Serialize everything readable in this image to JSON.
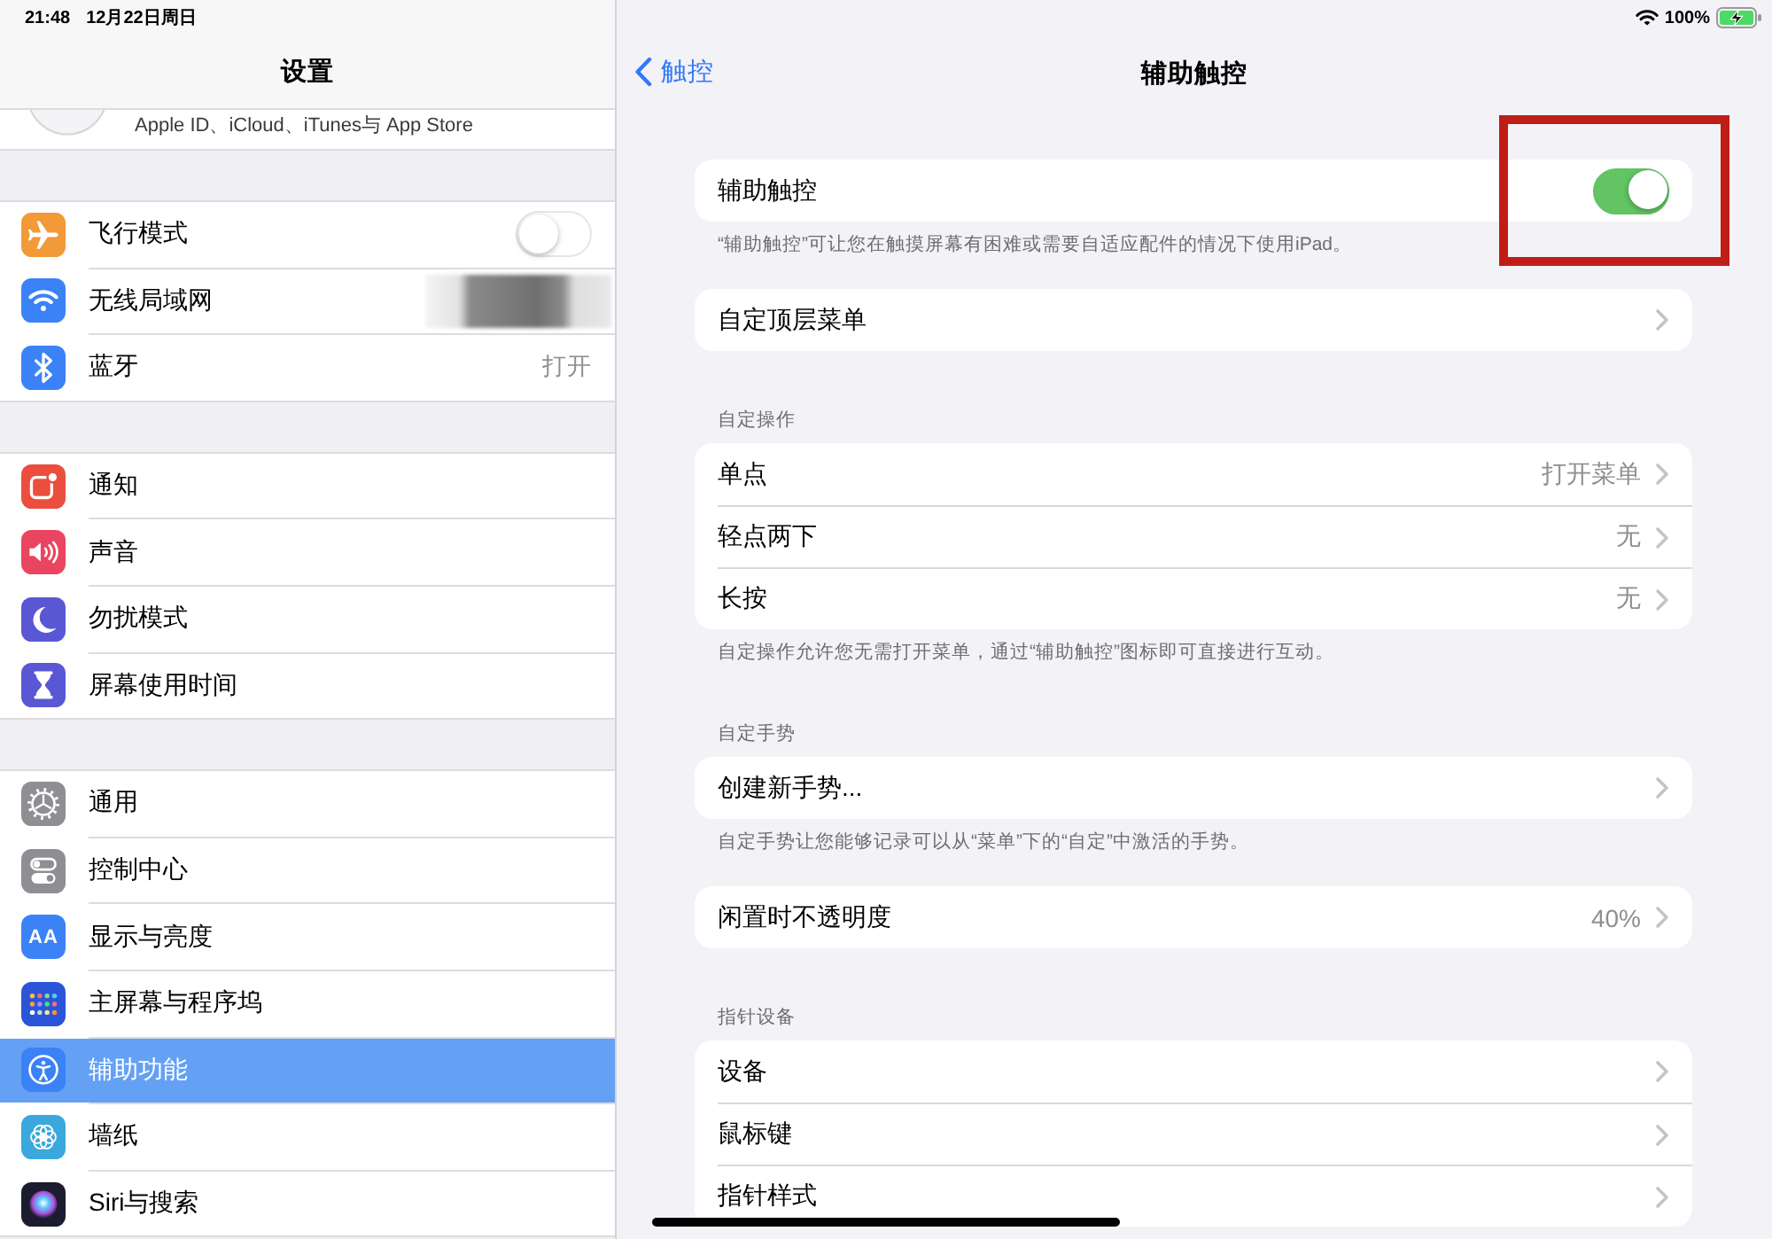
{
  "status_bar": {
    "time": "21:48",
    "date": "12月22日周日",
    "battery": "100%",
    "charging": true
  },
  "sidebar": {
    "title": "设置",
    "account": {
      "subtitle": "Apple ID、iCloud、iTunes与 App Store"
    },
    "groups": [
      {
        "items": [
          {
            "label": "飞行模式",
            "kind": "toggle",
            "on": false,
            "selected": false
          },
          {
            "label": "无线局域网",
            "kind": "hidden",
            "selected": false
          },
          {
            "label": "蓝牙",
            "kind": "value",
            "value": "打开",
            "selected": false
          }
        ]
      },
      {
        "items": [
          {
            "label": "通知",
            "kind": "plain",
            "selected": false
          },
          {
            "label": "声音",
            "kind": "plain",
            "selected": false
          },
          {
            "label": "勿扰模式",
            "kind": "plain",
            "selected": false
          },
          {
            "label": "屏幕使用时间",
            "kind": "plain",
            "selected": false
          }
        ]
      },
      {
        "items": [
          {
            "label": "通用",
            "kind": "plain",
            "selected": false
          },
          {
            "label": "控制中心",
            "kind": "plain",
            "selected": false
          },
          {
            "label": "显示与亮度",
            "kind": "plain",
            "icon_text": "AA",
            "selected": false
          },
          {
            "label": "主屏幕与程序坞",
            "kind": "plain",
            "selected": false
          },
          {
            "label": "辅助功能",
            "kind": "plain",
            "selected": true
          },
          {
            "label": "墙纸",
            "kind": "plain",
            "selected": false
          },
          {
            "label": "Siri与搜索",
            "kind": "plain",
            "selected": false
          }
        ]
      }
    ]
  },
  "detail": {
    "back": "触控",
    "title": "辅助触控",
    "sections": [
      {
        "rows": [
          {
            "label": "辅助触控",
            "kind": "toggle",
            "on": true,
            "highlighted": true
          }
        ],
        "footer": "“辅助触控”可让您在触摸屏幕有困难或需要自适应配件的情况下使用iPad。"
      },
      {
        "rows": [
          {
            "label": "自定顶层菜单",
            "kind": "link"
          }
        ]
      },
      {
        "header": "自定操作",
        "rows": [
          {
            "label": "单点",
            "kind": "link",
            "value": "打开菜单"
          },
          {
            "label": "轻点两下",
            "kind": "link",
            "value": "无"
          },
          {
            "label": "长按",
            "kind": "link",
            "value": "无"
          }
        ],
        "footer": "自定操作允许您无需打开菜单，通过“辅助触控”图标即可直接进行互动。"
      },
      {
        "header": "自定手势",
        "rows": [
          {
            "label": "创建新手势...",
            "kind": "link"
          }
        ],
        "footer": "自定手势让您能够记录可以从“菜单”下的“自定”中激活的手势。"
      },
      {
        "rows": [
          {
            "label": "闲置时不透明度",
            "kind": "link",
            "value": "40%"
          }
        ]
      },
      {
        "header": "指针设备",
        "rows": [
          {
            "label": "设备",
            "kind": "link"
          },
          {
            "label": "鼠标键",
            "kind": "link"
          },
          {
            "label": "指针样式",
            "kind": "link"
          }
        ]
      }
    ]
  }
}
